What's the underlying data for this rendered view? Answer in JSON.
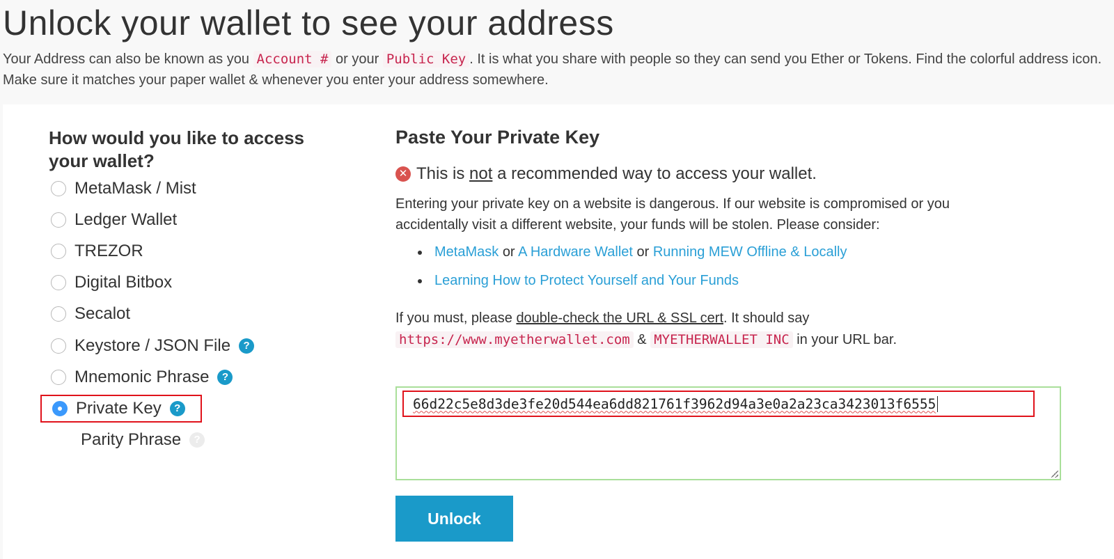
{
  "header": {
    "title": "Unlock your wallet to see your address",
    "desc_part1": "Your Address can also be known as you",
    "code_account": "Account #",
    "desc_or": "or your",
    "code_public_key": "Public Key",
    "desc_part2": ". It is what you share with people so they can send you Ether or Tokens. Find the colorful address icon. Make sure it matches your paper wallet & whenever you enter your address somewhere."
  },
  "access": {
    "heading": "How would you like to access your wallet?",
    "options": [
      {
        "label": "MetaMask / Mist",
        "checked": false,
        "help": false
      },
      {
        "label": "Ledger Wallet",
        "checked": false,
        "help": false
      },
      {
        "label": "TREZOR",
        "checked": false,
        "help": false
      },
      {
        "label": "Digital Bitbox",
        "checked": false,
        "help": false
      },
      {
        "label": "Secalot",
        "checked": false,
        "help": false
      },
      {
        "label": "Keystore / JSON File",
        "checked": false,
        "help": true
      },
      {
        "label": "Mnemonic Phrase",
        "checked": false,
        "help": true
      },
      {
        "label": "Private Key",
        "checked": true,
        "help": true
      },
      {
        "label": "Parity Phrase",
        "checked": false,
        "help": true
      }
    ],
    "help_glyph": "?"
  },
  "private_key": {
    "heading": "Paste Your Private Key",
    "warn_pre": "This is",
    "warn_not": "not",
    "warn_post": "a recommended way to access your wallet.",
    "warn_icon_glyph": "✕",
    "danger_text": "Entering your private key on a website is dangerous. If our website is compromised or you accidentally visit a different website, your funds will be stolen. Please consider:",
    "link_metamask": "MetaMask",
    "or1": "or",
    "link_hardware": "A Hardware Wallet",
    "or2": "or",
    "link_offline": "Running MEW Offline & Locally",
    "link_protect": "Learning How to Protect Yourself and Your Funds",
    "must_pre": "If you must, please",
    "must_link": "double-check the URL & SSL cert",
    "must_mid": ". It should say",
    "url_code": "https://www.myetherwallet.com",
    "amp": "&",
    "inc_code": "MYETHERWALLET INC",
    "must_post": "in your URL bar.",
    "key_value": "66d22c5e8d3de3fe20d544ea6dd821761f3962d94a3e0a2a23ca3423013f6555",
    "unlock_label": "Unlock"
  },
  "colors": {
    "accent": "#1a9ac9",
    "link": "#2a9fd6",
    "highlight_border": "#e0121b",
    "valid_border": "#a9df9a",
    "danger": "#d9534f"
  }
}
